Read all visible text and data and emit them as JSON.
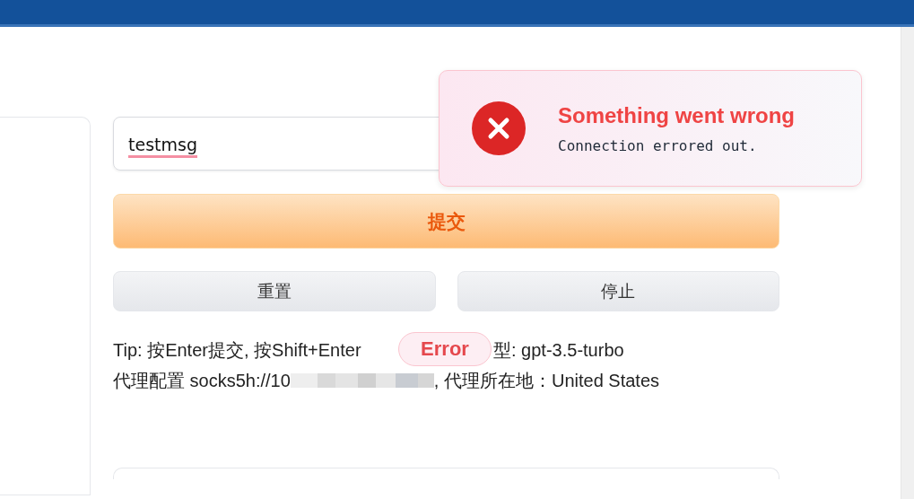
{
  "input": {
    "value": "testmsg",
    "spellcheck_error": true
  },
  "buttons": {
    "submit": "提交",
    "reset": "重置",
    "stop": "停止"
  },
  "info": {
    "tip_start": "Tip: 按Enter提交, 按Shift+Enter",
    "tip_end": "型: gpt-3.5-turbo",
    "proxy_start": "代理配置 socks5h://10",
    "proxy_end": ", 代理所在地：United States"
  },
  "error_badge": "Error",
  "toast": {
    "title": "Something went wrong",
    "message": "Connection errored out."
  }
}
